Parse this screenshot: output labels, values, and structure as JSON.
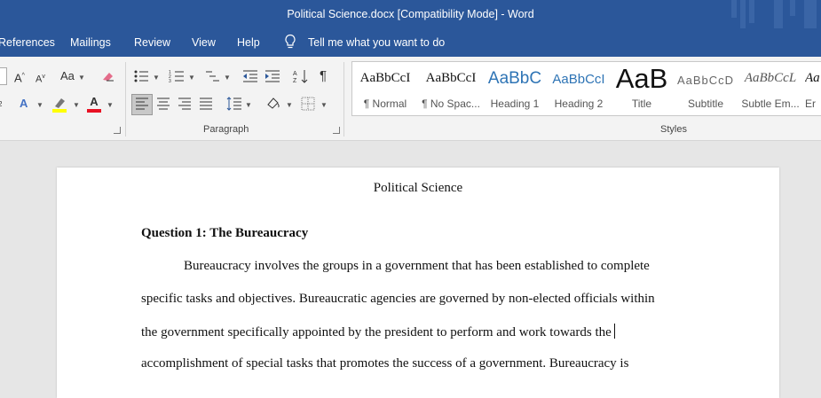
{
  "window": {
    "title": "Political Science.docx [Compatibility Mode]  -  Word"
  },
  "tabs": [
    "References",
    "Mailings",
    "Review",
    "View",
    "Help"
  ],
  "tell_me": "Tell me what you want to do",
  "groups": {
    "paragraph": "Paragraph",
    "styles": "Styles"
  },
  "styles": [
    {
      "sample": "AaBbCcI",
      "name": "¶ Normal"
    },
    {
      "sample": "AaBbCcI",
      "name": "¶ No Spac..."
    },
    {
      "sample": "AaBbC",
      "name": "Heading 1"
    },
    {
      "sample": "AaBbCcI",
      "name": "Heading 2"
    },
    {
      "sample": "AaB",
      "name": "Title"
    },
    {
      "sample": "AaBbCcD",
      "name": "Subtitle"
    },
    {
      "sample": "AaBbCcL",
      "name": "Subtle Em..."
    },
    {
      "sample": "Aa",
      "name": "Er"
    }
  ],
  "colors": {
    "title_bar": "#2b579a",
    "highlight": "#ffff00",
    "font_color": "#e81123"
  },
  "document": {
    "header": "Political Science",
    "heading": "Question 1: The Bureaucracy",
    "lines": [
      "Bureaucracy involves the groups in a government that has been established to complete",
      "specific tasks and objectives. Bureaucratic agencies are governed by non-elected officials within",
      "the government specifically appointed by the president to perform and work towards the",
      "accomplishment of special tasks that promotes the success of a government. Bureaucracy is"
    ]
  }
}
